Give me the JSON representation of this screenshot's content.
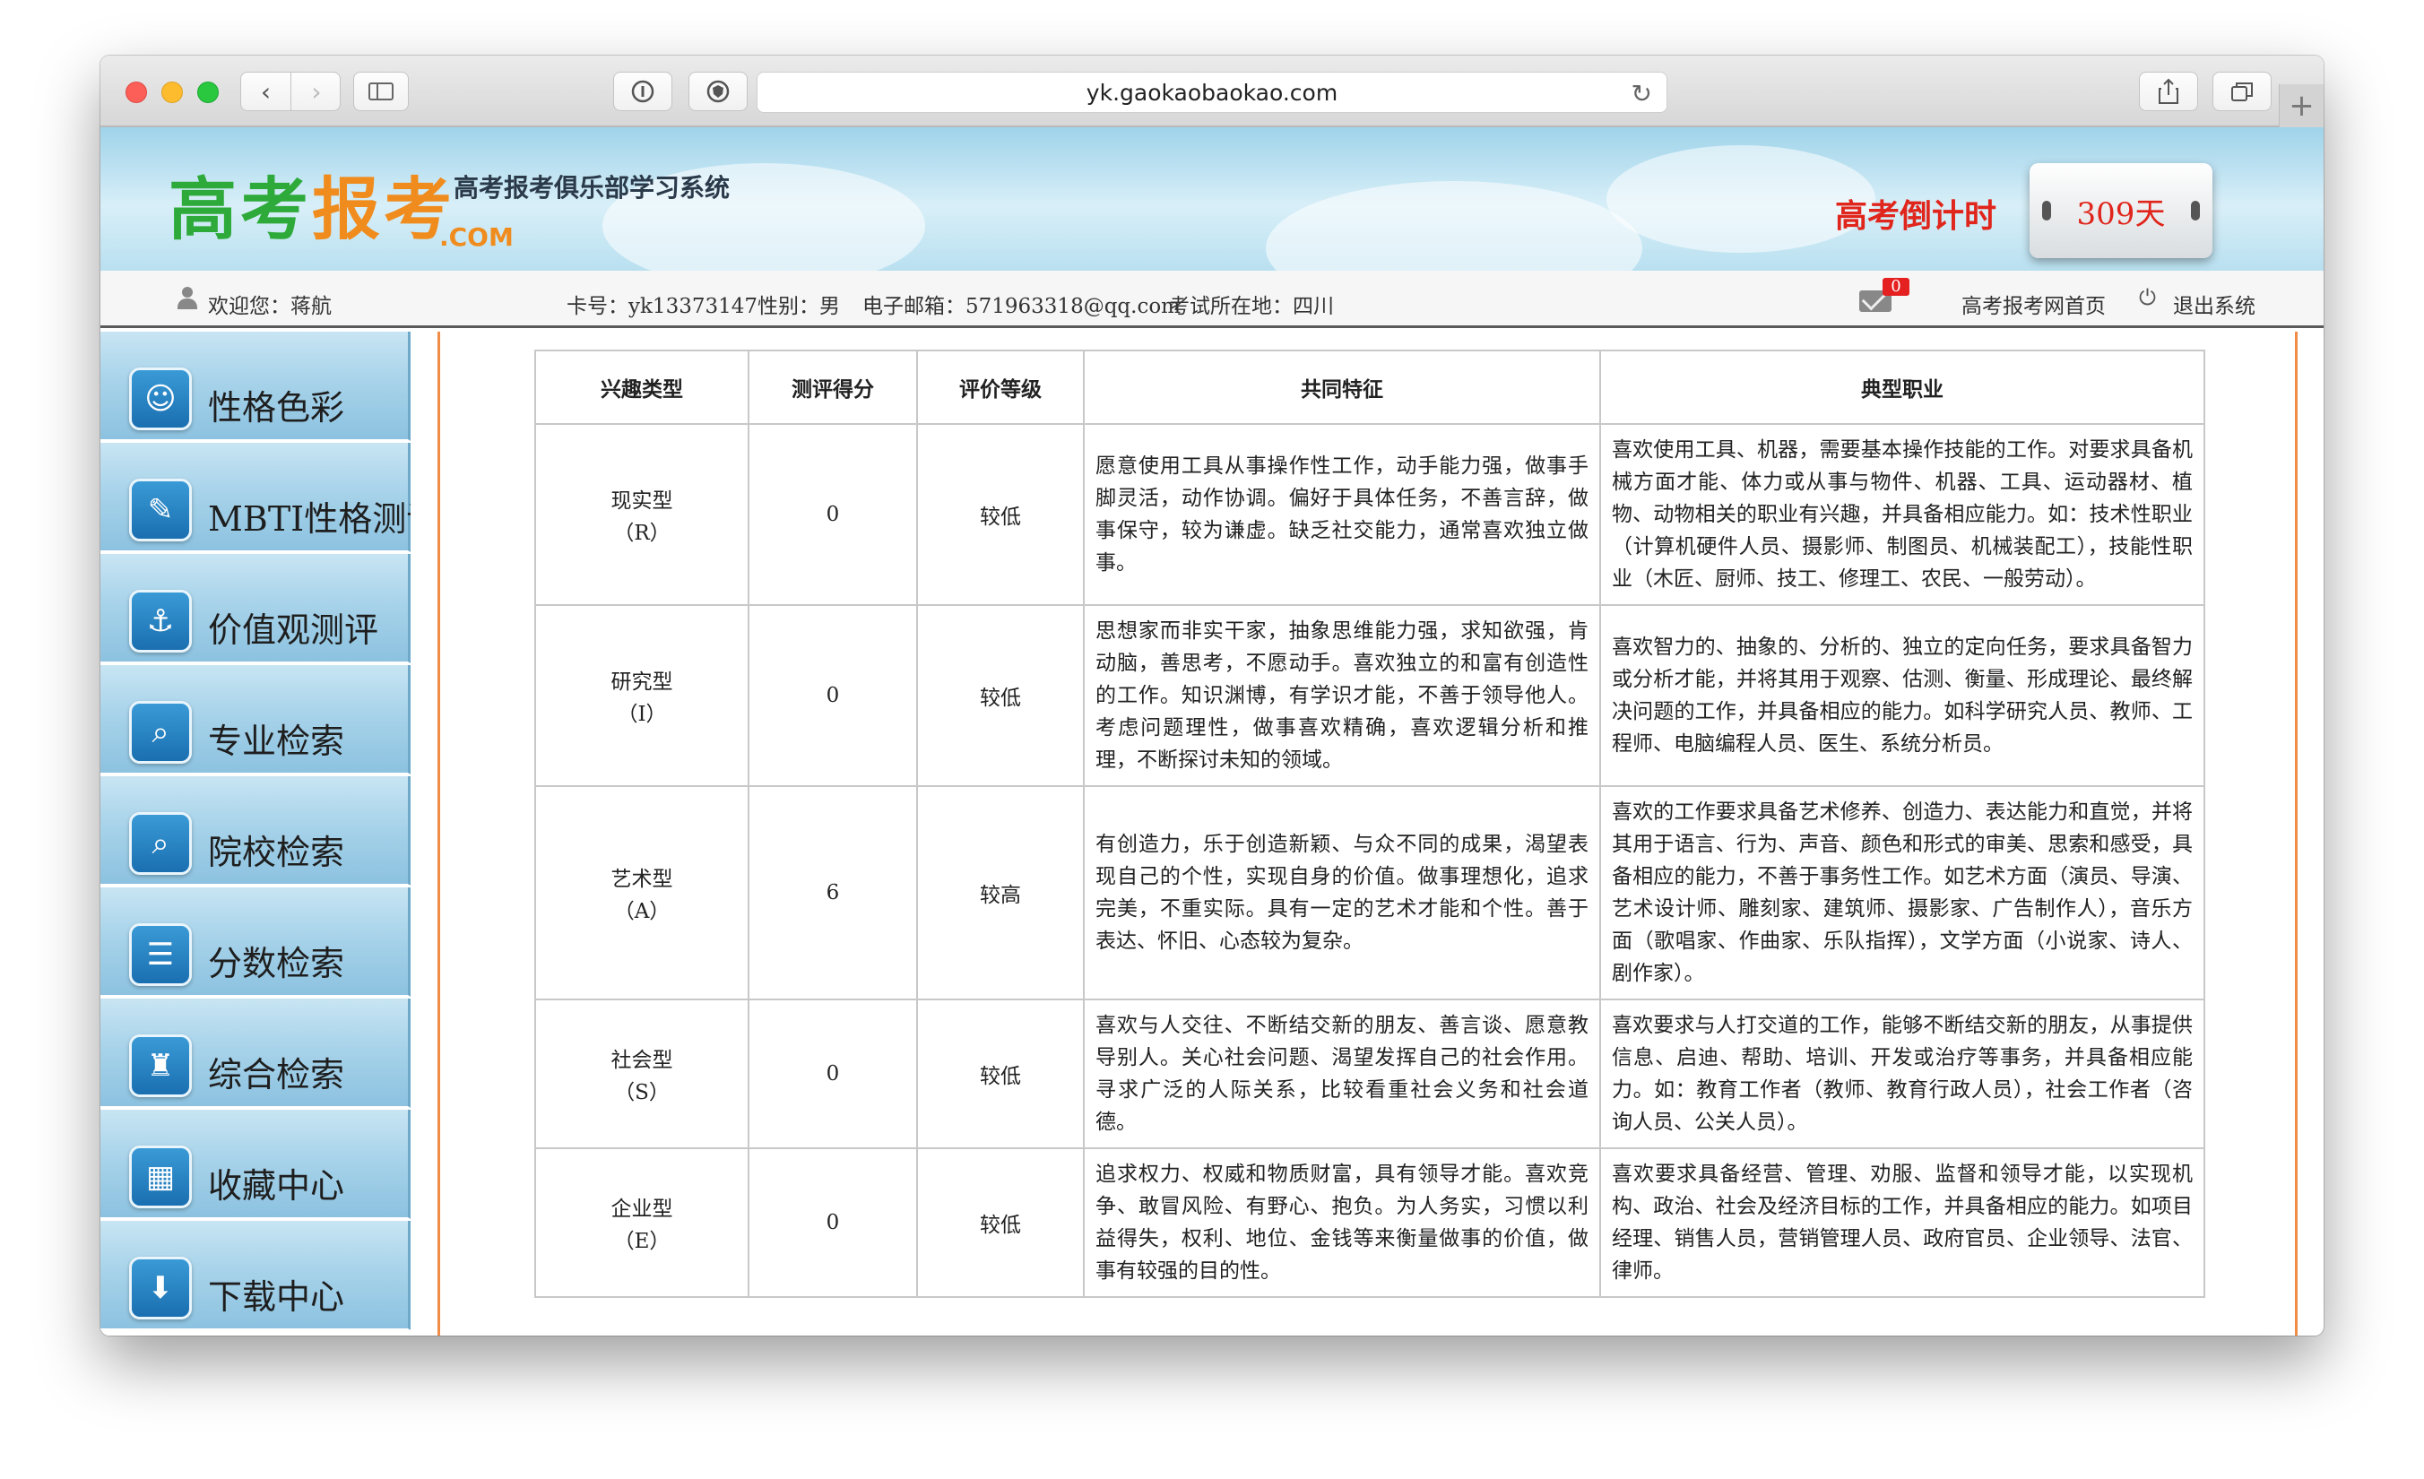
{
  "browser": {
    "url": "yk.gaokaobaokao.com"
  },
  "header": {
    "logo_part1": "高考",
    "logo_part2": "报考",
    "logo_com": ".COM",
    "subtitle": "高考报考俱乐部学习系统",
    "countdown_label": "高考倒计时",
    "countdown_value": "309天"
  },
  "userbar": {
    "welcome": "欢迎您：蒋航",
    "card": "卡号：yk13373147",
    "gender": "性别：男",
    "email": "电子邮箱：571963318@qq.com",
    "location": "考试所在地：四川",
    "mail_count": "0",
    "home_link": "高考报考网首页",
    "logout": "退出系统"
  },
  "sidebar": {
    "items": [
      {
        "label": "性格色彩",
        "icon": "mask-icon"
      },
      {
        "label": "MBTI性格测评",
        "icon": "feather-icon"
      },
      {
        "label": "价值观测评",
        "icon": "anchor-icon"
      },
      {
        "label": "专业检索",
        "icon": "magnifier-book-icon"
      },
      {
        "label": "院校检索",
        "icon": "magnifier-building-icon"
      },
      {
        "label": "分数检索",
        "icon": "list-icon"
      },
      {
        "label": "综合检索",
        "icon": "desk-icon"
      },
      {
        "label": "收藏中心",
        "icon": "buildings-icon"
      },
      {
        "label": "下载中心",
        "icon": "download-icon"
      }
    ]
  },
  "table": {
    "headers": [
      "兴趣类型",
      "测评得分",
      "评价等级",
      "共同特征",
      "典型职业"
    ],
    "rows": [
      {
        "type": "现实型",
        "code": "（R）",
        "score": "0",
        "level": "较低",
        "traits": "愿意使用工具从事操作性工作，动手能力强，做事手脚灵活，动作协调。偏好于具体任务，不善言辞，做事保守，较为谦虚。缺乏社交能力，通常喜欢独立做事。",
        "jobs": "喜欢使用工具、机器，需要基本操作技能的工作。对要求具备机械方面才能、体力或从事与物件、机器、工具、运动器材、植物、动物相关的职业有兴趣，并具备相应能力。如：技术性职业（计算机硬件人员、摄影师、制图员、机械装配工），技能性职业（木匠、厨师、技工、修理工、农民、一般劳动）。"
      },
      {
        "type": "研究型",
        "code": "（I）",
        "score": "0",
        "level": "较低",
        "traits": "思想家而非实干家，抽象思维能力强，求知欲强，肯动脑，善思考，不愿动手。喜欢独立的和富有创造性的工作。知识渊博，有学识才能，不善于领导他人。考虑问题理性，做事喜欢精确，喜欢逻辑分析和推理，不断探讨未知的领域。",
        "jobs": "喜欢智力的、抽象的、分析的、独立的定向任务，要求具备智力或分析才能，并将其用于观察、估测、衡量、形成理论、最终解决问题的工作，并具备相应的能力。如科学研究人员、教师、工程师、电脑编程人员、医生、系统分析员。"
      },
      {
        "type": "艺术型",
        "code": "（A）",
        "score": "6",
        "level": "较高",
        "traits": "有创造力，乐于创造新颖、与众不同的成果，渴望表现自己的个性，实现自身的价值。做事理想化，追求完美，不重实际。具有一定的艺术才能和个性。善于表达、怀旧、心态较为复杂。",
        "jobs": "喜欢的工作要求具备艺术修养、创造力、表达能力和直觉，并将其用于语言、行为、声音、颜色和形式的审美、思索和感受，具备相应的能力，不善于事务性工作。如艺术方面（演员、导演、艺术设计师、雕刻家、建筑师、摄影家、广告制作人），音乐方面（歌唱家、作曲家、乐队指挥），文学方面（小说家、诗人、剧作家）。"
      },
      {
        "type": "社会型",
        "code": "（S）",
        "score": "0",
        "level": "较低",
        "traits": "喜欢与人交往、不断结交新的朋友、善言谈、愿意教导别人。关心社会问题、渴望发挥自己的社会作用。寻求广泛的人际关系，比较看重社会义务和社会道德。",
        "jobs": "喜欢要求与人打交道的工作，能够不断结交新的朋友，从事提供信息、启迪、帮助、培训、开发或治疗等事务，并具备相应能力。如：教育工作者（教师、教育行政人员），社会工作者（咨询人员、公关人员）。"
      },
      {
        "type": "企业型",
        "code": "（E）",
        "score": "0",
        "level": "较低",
        "traits": "追求权力、权威和物质财富，具有领导才能。喜欢竞争、敢冒风险、有野心、抱负。为人务实，习惯以利益得失，权利、地位、金钱等来衡量做事的价值，做事有较强的目的性。",
        "jobs": "喜欢要求具备经营、管理、劝服、监督和领导才能，以实现机构、政治、社会及经济目标的工作，并具备相应的能力。如项目经理、销售人员，营销管理人员、政府官员、企业领导、法官、律师。"
      }
    ]
  }
}
